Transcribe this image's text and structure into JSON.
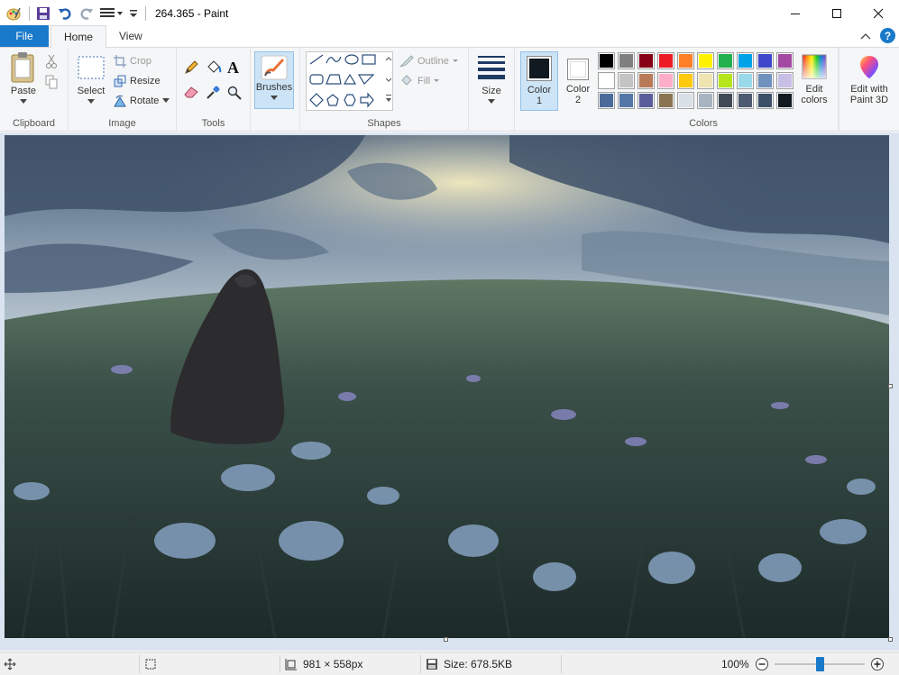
{
  "window": {
    "title": "264.365 - Paint"
  },
  "tabs": {
    "file": "File",
    "home": "Home",
    "view": "View"
  },
  "clipboard": {
    "paste": "Paste",
    "label": "Clipboard"
  },
  "image": {
    "select": "Select",
    "crop": "Crop",
    "resize": "Resize",
    "rotate": "Rotate",
    "label": "Image"
  },
  "tools": {
    "label": "Tools"
  },
  "brushes": {
    "label": "Brushes"
  },
  "shapes": {
    "outline": "Outline",
    "fill": "Fill",
    "label": "Shapes"
  },
  "size": {
    "label": "Size"
  },
  "colors": {
    "color1": "Color",
    "color1_num": "1",
    "color2": "Color",
    "color2_num": "2",
    "edit_line1": "Edit",
    "edit_line2": "colors",
    "paint3d_line1": "Edit with",
    "paint3d_line2": "Paint 3D",
    "label": "Colors",
    "color1_value": "#111a20",
    "color2_value": "#ffffff",
    "palette_row1": [
      "#000000",
      "#7f7f7f",
      "#880015",
      "#ed1c24",
      "#ff7f27",
      "#fff200",
      "#22b14c",
      "#00a2e8",
      "#3f48cc",
      "#a349a4"
    ],
    "palette_row2": [
      "#ffffff",
      "#c3c3c3",
      "#b97a57",
      "#ffaec9",
      "#ffc90e",
      "#efe4b0",
      "#b5e61d",
      "#99d9ea",
      "#7092be",
      "#c8bfe7"
    ],
    "palette_row3": [
      "#4a6b9a",
      "#5477a8",
      "#5a5d99",
      "#8a7350",
      "#d8dfe6",
      "#a8b4c0",
      "#404a55",
      "#4d5a70",
      "#3c5068",
      "#111a20"
    ]
  },
  "statusbar": {
    "dimensions": "981 × 558px",
    "size": "Size: 678.5KB",
    "zoom": "100%",
    "zoom_level": 0.5
  }
}
